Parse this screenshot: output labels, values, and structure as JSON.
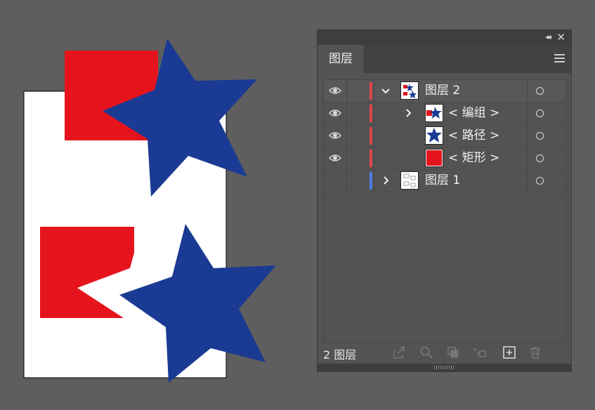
{
  "panel": {
    "tab_label": "图层",
    "footer_count": "2 图层"
  },
  "layers": [
    {
      "name": "图层 2",
      "expanded": true,
      "visible": true,
      "color": "#e0454a",
      "thumb": "layer2"
    },
    {
      "name": "< 编组 >",
      "expanded": false,
      "visible": true,
      "color": "#e0454a",
      "thumb": "group"
    },
    {
      "name": "< 路径 >",
      "visible": true,
      "color": "#e0454a",
      "thumb": "path"
    },
    {
      "name": "< 矩形 >",
      "visible": true,
      "color": "#e0454a",
      "thumb": "rect"
    },
    {
      "name": "图层 1",
      "expanded": false,
      "visible": false,
      "color": "#4a7be0",
      "thumb": "layer1"
    }
  ],
  "colors": {
    "background": "#5e5e5e",
    "panel": "#535353",
    "art_red": "#e5141c",
    "art_blue": "#1a3a93",
    "artboard": "#ffffff"
  },
  "icons": [
    "eye-icon",
    "chevron-down-icon",
    "chevron-right-icon",
    "target-circle-icon",
    "collapse-panel-icon",
    "close-icon",
    "panel-menu-icon",
    "export-icon",
    "search-icon",
    "clipping-mask-icon",
    "new-sublayer-icon",
    "new-layer-icon",
    "trash-icon"
  ]
}
